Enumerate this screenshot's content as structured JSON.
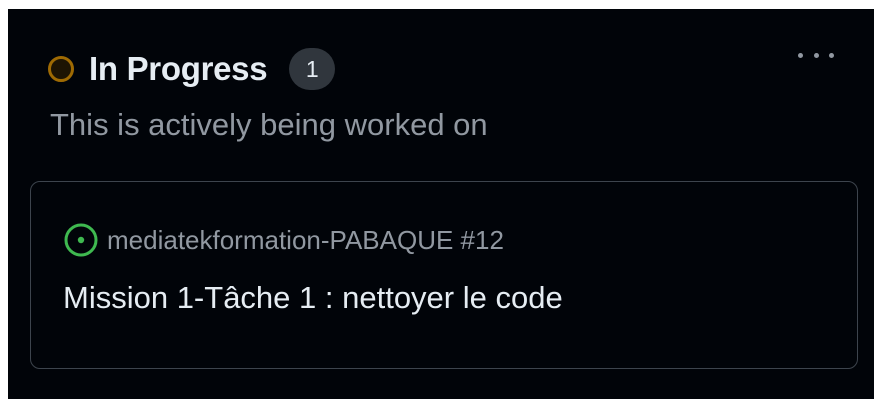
{
  "column": {
    "title": "In Progress",
    "count": "1",
    "description": "This is actively being worked on",
    "status_color": "#9e6a03",
    "menu_icon": "kebab-horizontal-icon"
  },
  "card": {
    "repo_ref": "mediatekformation-PABAQUE #12",
    "title": "Mission 1-Tâche 1 : nettoyer le code",
    "issue_state": "open",
    "issue_icon": "issue-opened-icon",
    "issue_color": "#3fb950"
  }
}
